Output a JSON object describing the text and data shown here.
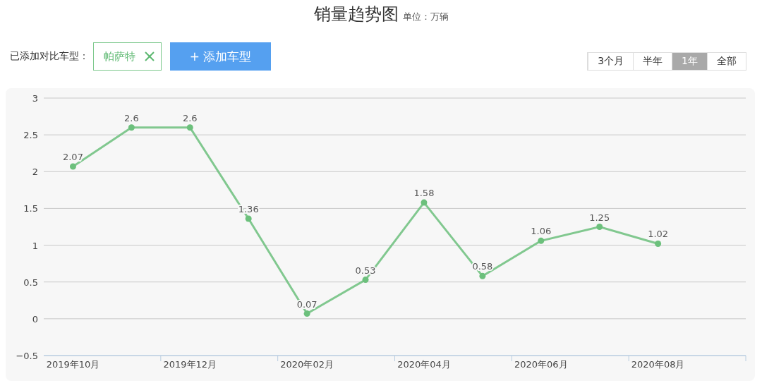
{
  "header": {
    "title": "销量趋势图",
    "unit": "单位：万辆"
  },
  "compare": {
    "label": "已添加对比车型：",
    "models": [
      {
        "name": "帕萨特"
      }
    ],
    "add_button": "+ 添加车型"
  },
  "ranges": [
    {
      "label": "3个月",
      "selected": false
    },
    {
      "label": "半年",
      "selected": false
    },
    {
      "label": "1年",
      "selected": true
    },
    {
      "label": "全部",
      "selected": false
    }
  ],
  "chart": {
    "chart_data": {
      "type": "line",
      "categories": [
        "2019年10月",
        null,
        "2019年12月",
        null,
        "2020年02月",
        null,
        "2020年04月",
        null,
        "2020年06月",
        null,
        "2020年08月",
        null
      ],
      "grid": true,
      "series": [
        {
          "color": "#6cc07c",
          "marker": "circle",
          "values": [
            2.07,
            2.6,
            2.6,
            1.36,
            0.07,
            0.53,
            1.58,
            0.58,
            1.06,
            1.25,
            1.02,
            null
          ]
        }
      ],
      "value_labels": [
        "2.07",
        "2.6",
        "2.6",
        "1.36",
        "0.07",
        "0.53",
        "1.58",
        "0.58",
        "1.06",
        "1.25",
        "1.02",
        null
      ],
      "ylim": [
        -0.5,
        3
      ],
      "yticks": [
        {
          "value": -0.5,
          "label": "−0.5"
        },
        {
          "value": 0,
          "label": "0"
        },
        {
          "value": 0.5,
          "label": "0.5"
        },
        {
          "value": 1,
          "label": "1"
        },
        {
          "value": 1.5,
          "label": "1.5"
        },
        {
          "value": 2,
          "label": "2"
        },
        {
          "value": 2.5,
          "label": "2.5"
        },
        {
          "value": 3,
          "label": "3"
        }
      ]
    }
  }
}
